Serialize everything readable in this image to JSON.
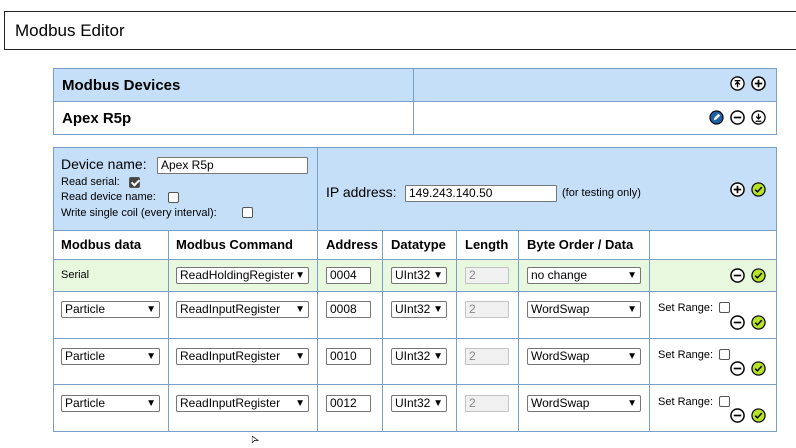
{
  "window": {
    "title": "Modbus Editor"
  },
  "devices_panel": {
    "title": "Modbus Devices",
    "selected_device": "Apex R5p"
  },
  "device_form": {
    "device_name_label": "Device name:",
    "device_name_value": "Apex R5p",
    "read_serial_label": "Read serial:",
    "read_serial_checked": true,
    "read_device_name_label": "Read device name:",
    "read_device_name_checked": false,
    "write_single_coil_label": "Write single coil (every interval):",
    "write_single_coil_checked": false,
    "ip_label": "IP address:",
    "ip_value": "149.243.140.50",
    "ip_note": "(for testing only)"
  },
  "table": {
    "headers": [
      "Modbus data",
      "Modbus Command",
      "Address",
      "Datatype",
      "Length",
      "Byte Order / Data"
    ],
    "rows": [
      {
        "data": "Serial",
        "command": "ReadHoldingRegister",
        "address": "0004",
        "datatype": "UInt32",
        "length": "2",
        "byte_order": "no change",
        "set_range_label": ""
      },
      {
        "data": "Particle",
        "command": "ReadInputRegister",
        "address": "0008",
        "datatype": "UInt32",
        "length": "2",
        "byte_order": "WordSwap",
        "set_range_label": "Set Range:"
      },
      {
        "data": "Particle",
        "command": "ReadInputRegister",
        "address": "0010",
        "datatype": "UInt32",
        "length": "2",
        "byte_order": "WordSwap",
        "set_range_label": "Set Range:"
      },
      {
        "data": "Particle",
        "command": "ReadInputRegister",
        "address": "0012",
        "datatype": "UInt32",
        "length": "2",
        "byte_order": "WordSwap",
        "set_range_label": "Set Range:"
      }
    ]
  },
  "icons": {
    "upload": "upload-icon",
    "add": "plus-circle-icon",
    "edit": "pencil-icon",
    "remove": "minus-circle-icon",
    "download": "download-icon",
    "confirm": "check-circle-icon"
  },
  "colors": {
    "panel_blue": "#c5dff8",
    "row_green": "#e8f8df",
    "confirm_green": "#b7e326",
    "border": "#7a9fc7"
  }
}
